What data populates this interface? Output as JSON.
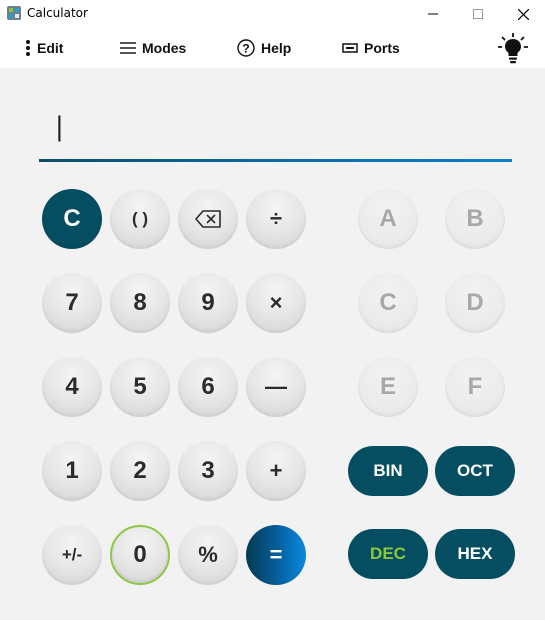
{
  "window": {
    "title": "Calculator",
    "minimize": "—",
    "maximize": "☐",
    "close": "✕"
  },
  "menu": {
    "edit": "Edit",
    "modes": "Modes",
    "help": "Help",
    "ports": "Ports"
  },
  "display": {
    "value": "|"
  },
  "keypad": {
    "row1": [
      "C",
      "( )",
      "⌫",
      "÷"
    ],
    "row2": [
      "7",
      "8",
      "9",
      "×"
    ],
    "row3": [
      "4",
      "5",
      "6",
      "—"
    ],
    "row4": [
      "1",
      "2",
      "3",
      "+"
    ],
    "row5": [
      "+/-",
      "0",
      "%",
      "="
    ]
  },
  "hex_digits": [
    "A",
    "B",
    "C",
    "D",
    "E",
    "F"
  ],
  "bases": {
    "bin": "BIN",
    "oct": "OCT",
    "dec": "DEC",
    "hex": "HEX",
    "selected": "DEC"
  },
  "colors": {
    "accent_dark": "#054d60",
    "accent_blue": "#0a7fd0",
    "selected_base_text": "#8cc63f",
    "zero_ring": "#8fc846"
  },
  "icons": {
    "edit": "vertical-dots-icon",
    "modes": "hamburger-icon",
    "help": "question-circle-icon",
    "ports": "port-icon",
    "theme": "lightbulb-icon",
    "backspace": "backspace-icon"
  }
}
